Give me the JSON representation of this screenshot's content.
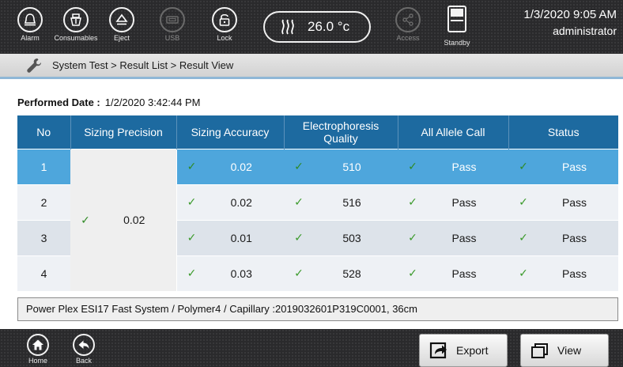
{
  "topbar": {
    "buttons": [
      {
        "label": "Alarm",
        "icon": "alarm-bell-icon"
      },
      {
        "label": "Consumables",
        "icon": "consumables-icon"
      },
      {
        "label": "Eject",
        "icon": "eject-icon"
      },
      {
        "label": "USB",
        "icon": "usb-icon"
      },
      {
        "label": "Lock",
        "icon": "lock-icon"
      },
      {
        "label": "Access",
        "icon": "share-icon"
      },
      {
        "label": "Standby",
        "icon": "standby-icon"
      }
    ],
    "temperature": "26.0 °c",
    "datetime": "1/3/2020 9:05 AM",
    "user": "administrator"
  },
  "breadcrumb": "System Test > Result List > Result View",
  "performed": {
    "label": "Performed Date :",
    "value": "1/2/2020 3:42:44 PM"
  },
  "table": {
    "headers": [
      "No",
      "Sizing Precision",
      "Sizing Accuracy",
      "Electrophoresis Quality",
      "All Allele Call",
      "Status"
    ],
    "sizing_precision": "0.02",
    "check": "✓",
    "rows": [
      {
        "no": "1",
        "accuracy": "0.02",
        "quality": "510",
        "allele": "Pass",
        "status": "Pass"
      },
      {
        "no": "2",
        "accuracy": "0.02",
        "quality": "516",
        "allele": "Pass",
        "status": "Pass"
      },
      {
        "no": "3",
        "accuracy": "0.01",
        "quality": "503",
        "allele": "Pass",
        "status": "Pass"
      },
      {
        "no": "4",
        "accuracy": "0.03",
        "quality": "528",
        "allele": "Pass",
        "status": "Pass"
      }
    ]
  },
  "info": "Power Plex ESI17 Fast System / Polymer4 / Capillary :2019032601P319C0001, 36cm",
  "bottombar": {
    "home": "Home",
    "back": "Back",
    "export": "Export",
    "view": "View"
  },
  "colors": {
    "header_blue": "#1d6aa0",
    "selected_row": "#4ea6dc",
    "check_green": "#3a9a2a"
  }
}
